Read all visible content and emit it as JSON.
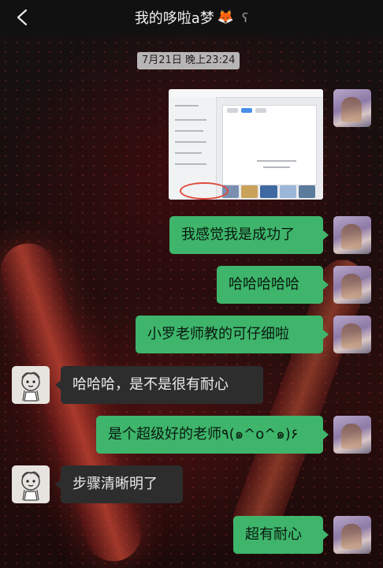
{
  "header": {
    "title": "我的哆啦a梦",
    "title_emoji": "🦊",
    "ear_icon": "ʕ"
  },
  "timestamp": "7月21日 晚上23:24",
  "messages": [
    {
      "from": "me",
      "type": "image"
    },
    {
      "from": "me",
      "type": "text",
      "text": "我感觉我是成功了"
    },
    {
      "from": "me",
      "type": "text",
      "text": "哈哈哈哈哈"
    },
    {
      "from": "me",
      "type": "text",
      "text": "小罗老师教的可仔细啦"
    },
    {
      "from": "other",
      "type": "text",
      "text": "哈哈哈，是不是很有耐心"
    },
    {
      "from": "me",
      "type": "text",
      "text": "是个超级好的老师٩(๑^o^๑)۶"
    },
    {
      "from": "other",
      "type": "text",
      "text": "步骤清晰明了"
    },
    {
      "from": "me",
      "type": "text",
      "text": "超有耐心"
    }
  ],
  "colors": {
    "my_bubble": "#3eb56b",
    "other_bubble": "#2d2d2d",
    "header_bg": "#121212"
  },
  "icons": [
    "back-arrow-icon",
    "ear-icon"
  ]
}
